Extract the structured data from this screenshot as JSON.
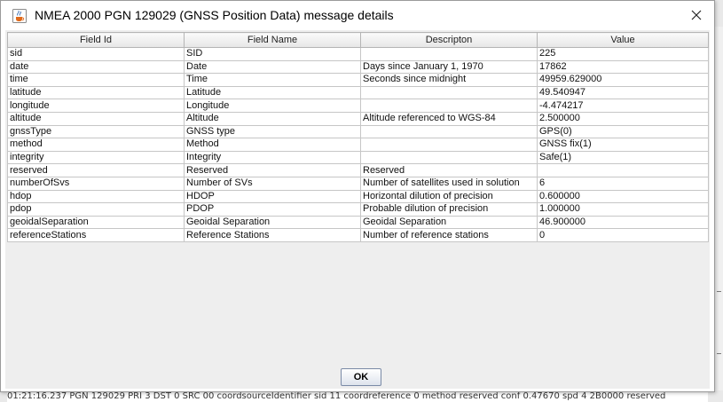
{
  "window": {
    "title": "NMEA 2000 PGN 129029 (GNSS Position Data) message details",
    "close_symbol": "✕"
  },
  "table": {
    "columns": [
      "Field Id",
      "Field Name",
      "Descripton",
      "Value"
    ],
    "rows": [
      [
        "sid",
        "SID",
        "",
        "225"
      ],
      [
        "date",
        "Date",
        "Days since January 1, 1970",
        "17862"
      ],
      [
        "time",
        "Time",
        "Seconds since midnight",
        "49959.629000"
      ],
      [
        "latitude",
        "Latitude",
        "",
        "49.540947"
      ],
      [
        "longitude",
        "Longitude",
        "",
        "-4.474217"
      ],
      [
        "altitude",
        "Altitude",
        "Altitude referenced to WGS-84",
        "2.500000"
      ],
      [
        "gnssType",
        "GNSS type",
        "",
        "GPS(0)"
      ],
      [
        "method",
        "Method",
        "",
        "GNSS fix(1)"
      ],
      [
        "integrity",
        "Integrity",
        "",
        "Safe(1)"
      ],
      [
        "reserved",
        "Reserved",
        "Reserved",
        ""
      ],
      [
        "numberOfSvs",
        "Number of SVs",
        "Number of satellites used in solution",
        "6"
      ],
      [
        "hdop",
        "HDOP",
        "Horizontal dilution of precision",
        "0.600000"
      ],
      [
        "pdop",
        "PDOP",
        "Probable dilution of precision",
        "1.000000"
      ],
      [
        "geoidalSeparation",
        "Geoidal Separation",
        "Geoidal Separation",
        "46.900000"
      ],
      [
        "referenceStations",
        "Reference Stations",
        "Number of reference stations",
        "0"
      ]
    ]
  },
  "buttons": {
    "ok_label": "OK"
  },
  "background": {
    "log_line": "01:21:16.237 PGN 129029 PRI 3 DST 0 SRC 00 coordsourceIdentifier sid 11 coordreference 0 method reserved conf 0.47670 spd 4 2B0000 reserved"
  },
  "icons": {
    "app": "java-cup-icon",
    "close": "close-icon"
  }
}
